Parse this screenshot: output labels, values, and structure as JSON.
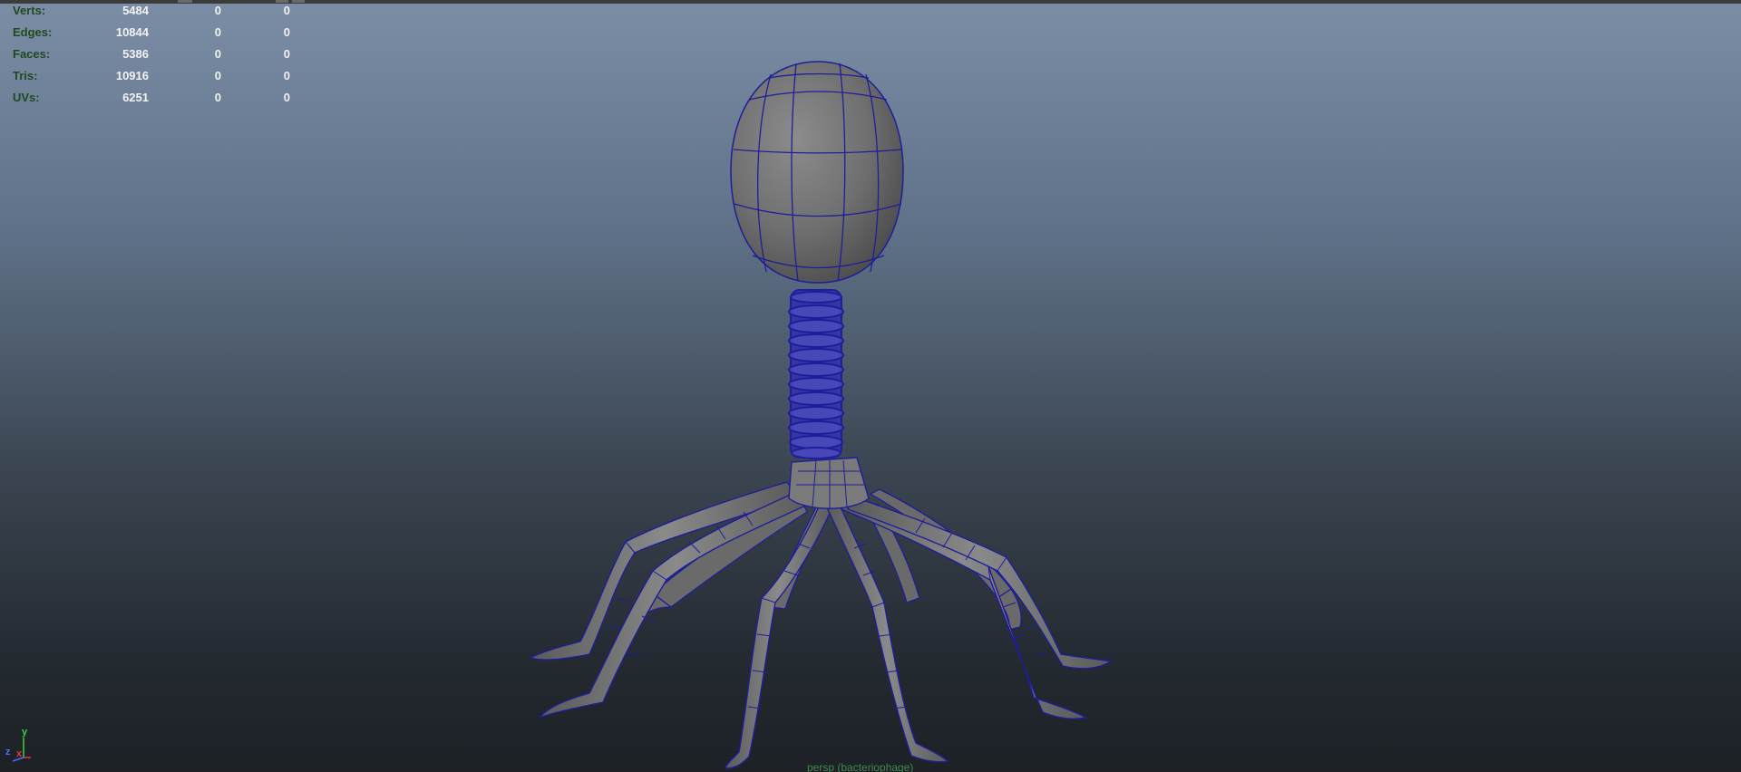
{
  "heads_up_display": {
    "rows": [
      {
        "label": "Verts:",
        "values": [
          "5484",
          "0",
          "0"
        ]
      },
      {
        "label": "Edges:",
        "values": [
          "10844",
          "0",
          "0"
        ]
      },
      {
        "label": "Faces:",
        "values": [
          "5386",
          "0",
          "0"
        ]
      },
      {
        "label": "Tris:",
        "values": [
          "10916",
          "0",
          "0"
        ]
      },
      {
        "label": "UVs:",
        "values": [
          "6251",
          "0",
          "0"
        ]
      }
    ]
  },
  "view_axis": {
    "y_label": "y",
    "x_label": "x",
    "z_label": "z"
  },
  "camera": {
    "label": "persp (bacteriophage)"
  },
  "colors": {
    "wireframe": "#1e1e9a",
    "mesh_fill": "#747474",
    "hud_label": "#1f4a1f",
    "hud_value": "#f2f2f2"
  }
}
